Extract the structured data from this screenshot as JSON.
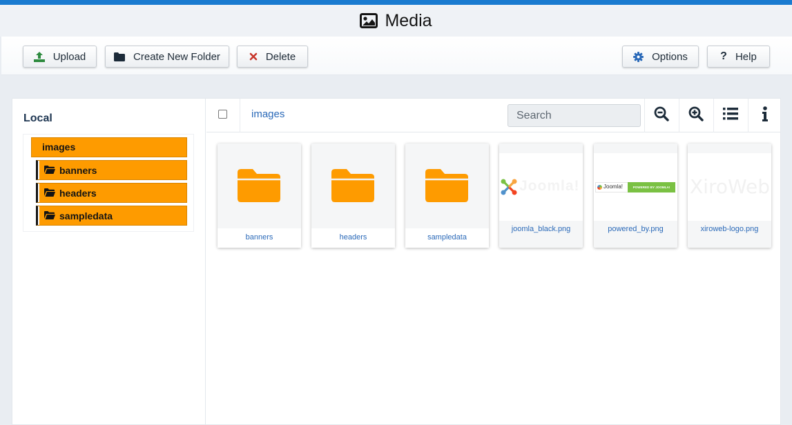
{
  "header": {
    "title": "Media",
    "icon": "image-icon"
  },
  "toolbar": {
    "upload_label": "Upload",
    "new_folder_label": "Create New Folder",
    "delete_label": "Delete",
    "options_label": "Options",
    "help_label": "Help"
  },
  "sidebar": {
    "title": "Local",
    "root": "images",
    "folders": [
      "banners",
      "headers",
      "sampledata"
    ]
  },
  "content": {
    "breadcrumb": "images",
    "search_placeholder": "Search",
    "items": [
      {
        "name": "banners",
        "type": "folder"
      },
      {
        "name": "headers",
        "type": "folder"
      },
      {
        "name": "sampledata",
        "type": "folder"
      },
      {
        "name": "joomla_black.png",
        "type": "image"
      },
      {
        "name": "powered_by.png",
        "type": "image"
      },
      {
        "name": "xiroweb-logo.png",
        "type": "image"
      }
    ],
    "thumbnails": {
      "joomla_text": "Joomla!",
      "powered_by_text": "Joomla!",
      "powered_by_badge": "POWERED BY JOOMLA!",
      "xiroweb_text": "XiroWeb"
    }
  },
  "colors": {
    "accent": "#1a7bd0",
    "folder": "#fe9b00",
    "link": "#2a69b8"
  }
}
